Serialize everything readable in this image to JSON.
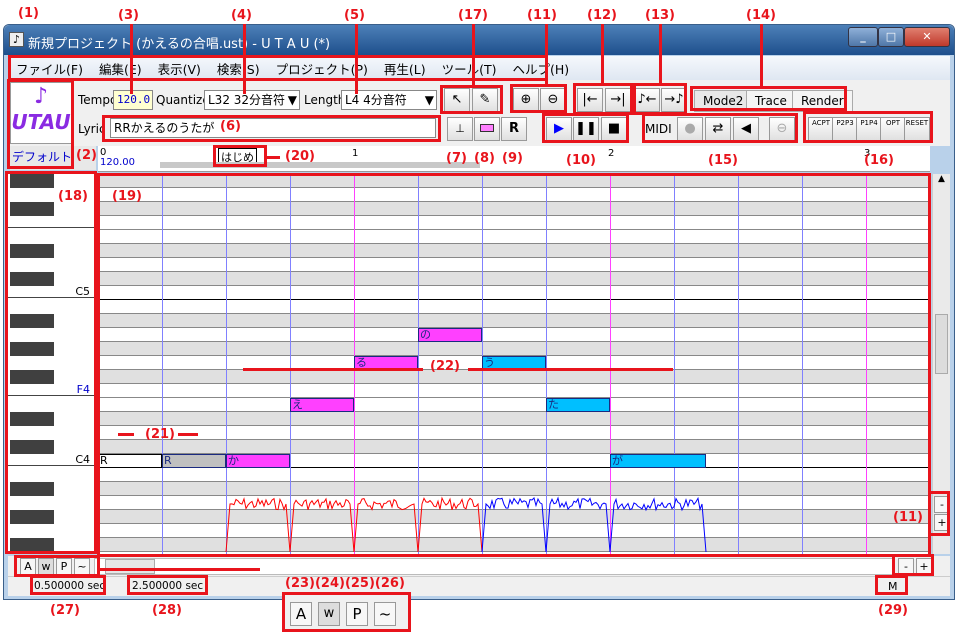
{
  "window": {
    "title": "新規プロジェクト (かえるの合唱.ust) - U T A U (*)",
    "icon": "music-note-icon",
    "controls": [
      "minimize-icon",
      "maximize-icon",
      "close-icon"
    ]
  },
  "menu": [
    "ファイル(F)",
    "編集(E)",
    "表示(V)",
    "検索(S)",
    "プロジェクト(P)",
    "再生(L)",
    "ツール(T)",
    "ヘルプ(H)"
  ],
  "toolbar": {
    "logo": "UTAU",
    "tempo_label": "Tempo",
    "tempo_value": "120.0",
    "quantize_label": "Quantize",
    "quantize_value": "L32 32分音符",
    "length_label": "Length",
    "length_value": "L4  4分音符",
    "lyric_label": "Lyric",
    "lyric_value": "RRかえるのうたが",
    "midi_label": "MIDI",
    "modes": [
      "Mode2",
      "Trace",
      "Render"
    ],
    "env_buttons": [
      "ACPT",
      "P2P3",
      "P1P4",
      "OPT",
      "RESET"
    ]
  },
  "voicebank": "デフォルト",
  "ruler": {
    "start": "0",
    "tempo": "120.00",
    "flag": "はじめ",
    "measures": [
      "1",
      "2",
      "3"
    ]
  },
  "piano": {
    "labels": {
      "C5": "C5",
      "F4": "F4",
      "C4": "C4"
    }
  },
  "notes": [
    {
      "lyric": "R",
      "pitch": "C4",
      "start": 0,
      "len": 1,
      "type": "rest"
    },
    {
      "lyric": "R",
      "pitch": "C4",
      "start": 1,
      "len": 1,
      "type": "rest-selected"
    },
    {
      "lyric": "か",
      "pitch": "C4",
      "start": 2,
      "len": 1,
      "type": "a"
    },
    {
      "lyric": "え",
      "pitch": "E4",
      "start": 3,
      "len": 1,
      "type": "a"
    },
    {
      "lyric": "る",
      "pitch": "G4",
      "start": 4,
      "len": 1,
      "type": "a"
    },
    {
      "lyric": "の",
      "pitch": "A4",
      "start": 5,
      "len": 1,
      "type": "a"
    },
    {
      "lyric": "う",
      "pitch": "G4",
      "start": 6,
      "len": 1,
      "type": "b"
    },
    {
      "lyric": "た",
      "pitch": "E4",
      "start": 7,
      "len": 1,
      "type": "b"
    },
    {
      "lyric": "が",
      "pitch": "C4",
      "start": 8,
      "len": 1.5,
      "type": "b"
    }
  ],
  "colors": {
    "note_a": "#ff40ff",
    "note_b": "#00bfff",
    "rest_selected": "#c0c0c0",
    "pitch_a": "#ff0000",
    "pitch_b": "#0000ff",
    "annotation": "#e8141c",
    "beat_line": "#8080ff",
    "measure_line": "#ff40ff"
  },
  "bottom": {
    "view_buttons": [
      "A",
      "w",
      "P",
      "~"
    ],
    "zoom_minus": "-",
    "zoom_plus": "+",
    "time1": "0.500000 sec",
    "time2": "2.500000 sec",
    "m_label": "M"
  },
  "annotations": [
    "(1)",
    "(2)",
    "(3)",
    "(4)",
    "(5)",
    "(6)",
    "(7)",
    "(8)",
    "(9)",
    "(10)",
    "(11)",
    "(12)",
    "(13)",
    "(14)",
    "(15)",
    "(16)",
    "(17)",
    "(18)",
    "(19)",
    "(20)",
    "(21)",
    "(22)",
    "(23)(24)(25)(26)",
    "(27)",
    "(28)",
    "(29)",
    "(11)"
  ]
}
